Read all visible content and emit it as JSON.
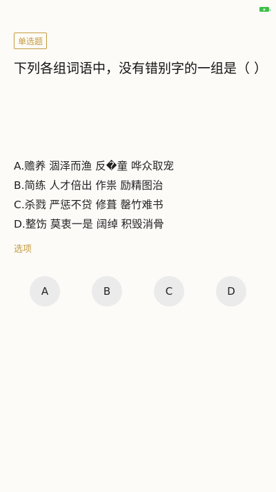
{
  "question": {
    "type_label": "单选题",
    "text": "下列各组词语中，没有错别字的一组是（ ）",
    "options": [
      "A.赡养 涸泽而渔 反�童 哗众取宠",
      "B.简练 人才倍出 作祟 励精图治",
      "C.杀戮 严惩不贷 修葺 罄竹难书",
      "D.整饬 莫衷一是 阔绰 积毁消骨"
    ]
  },
  "options_section": {
    "label": "选项"
  },
  "answers": [
    "A",
    "B",
    "C",
    "D"
  ],
  "colors": {
    "accent": "#c59b3d",
    "battery": "#3fbf4a",
    "answer_button_bg": "#ebebeb"
  }
}
